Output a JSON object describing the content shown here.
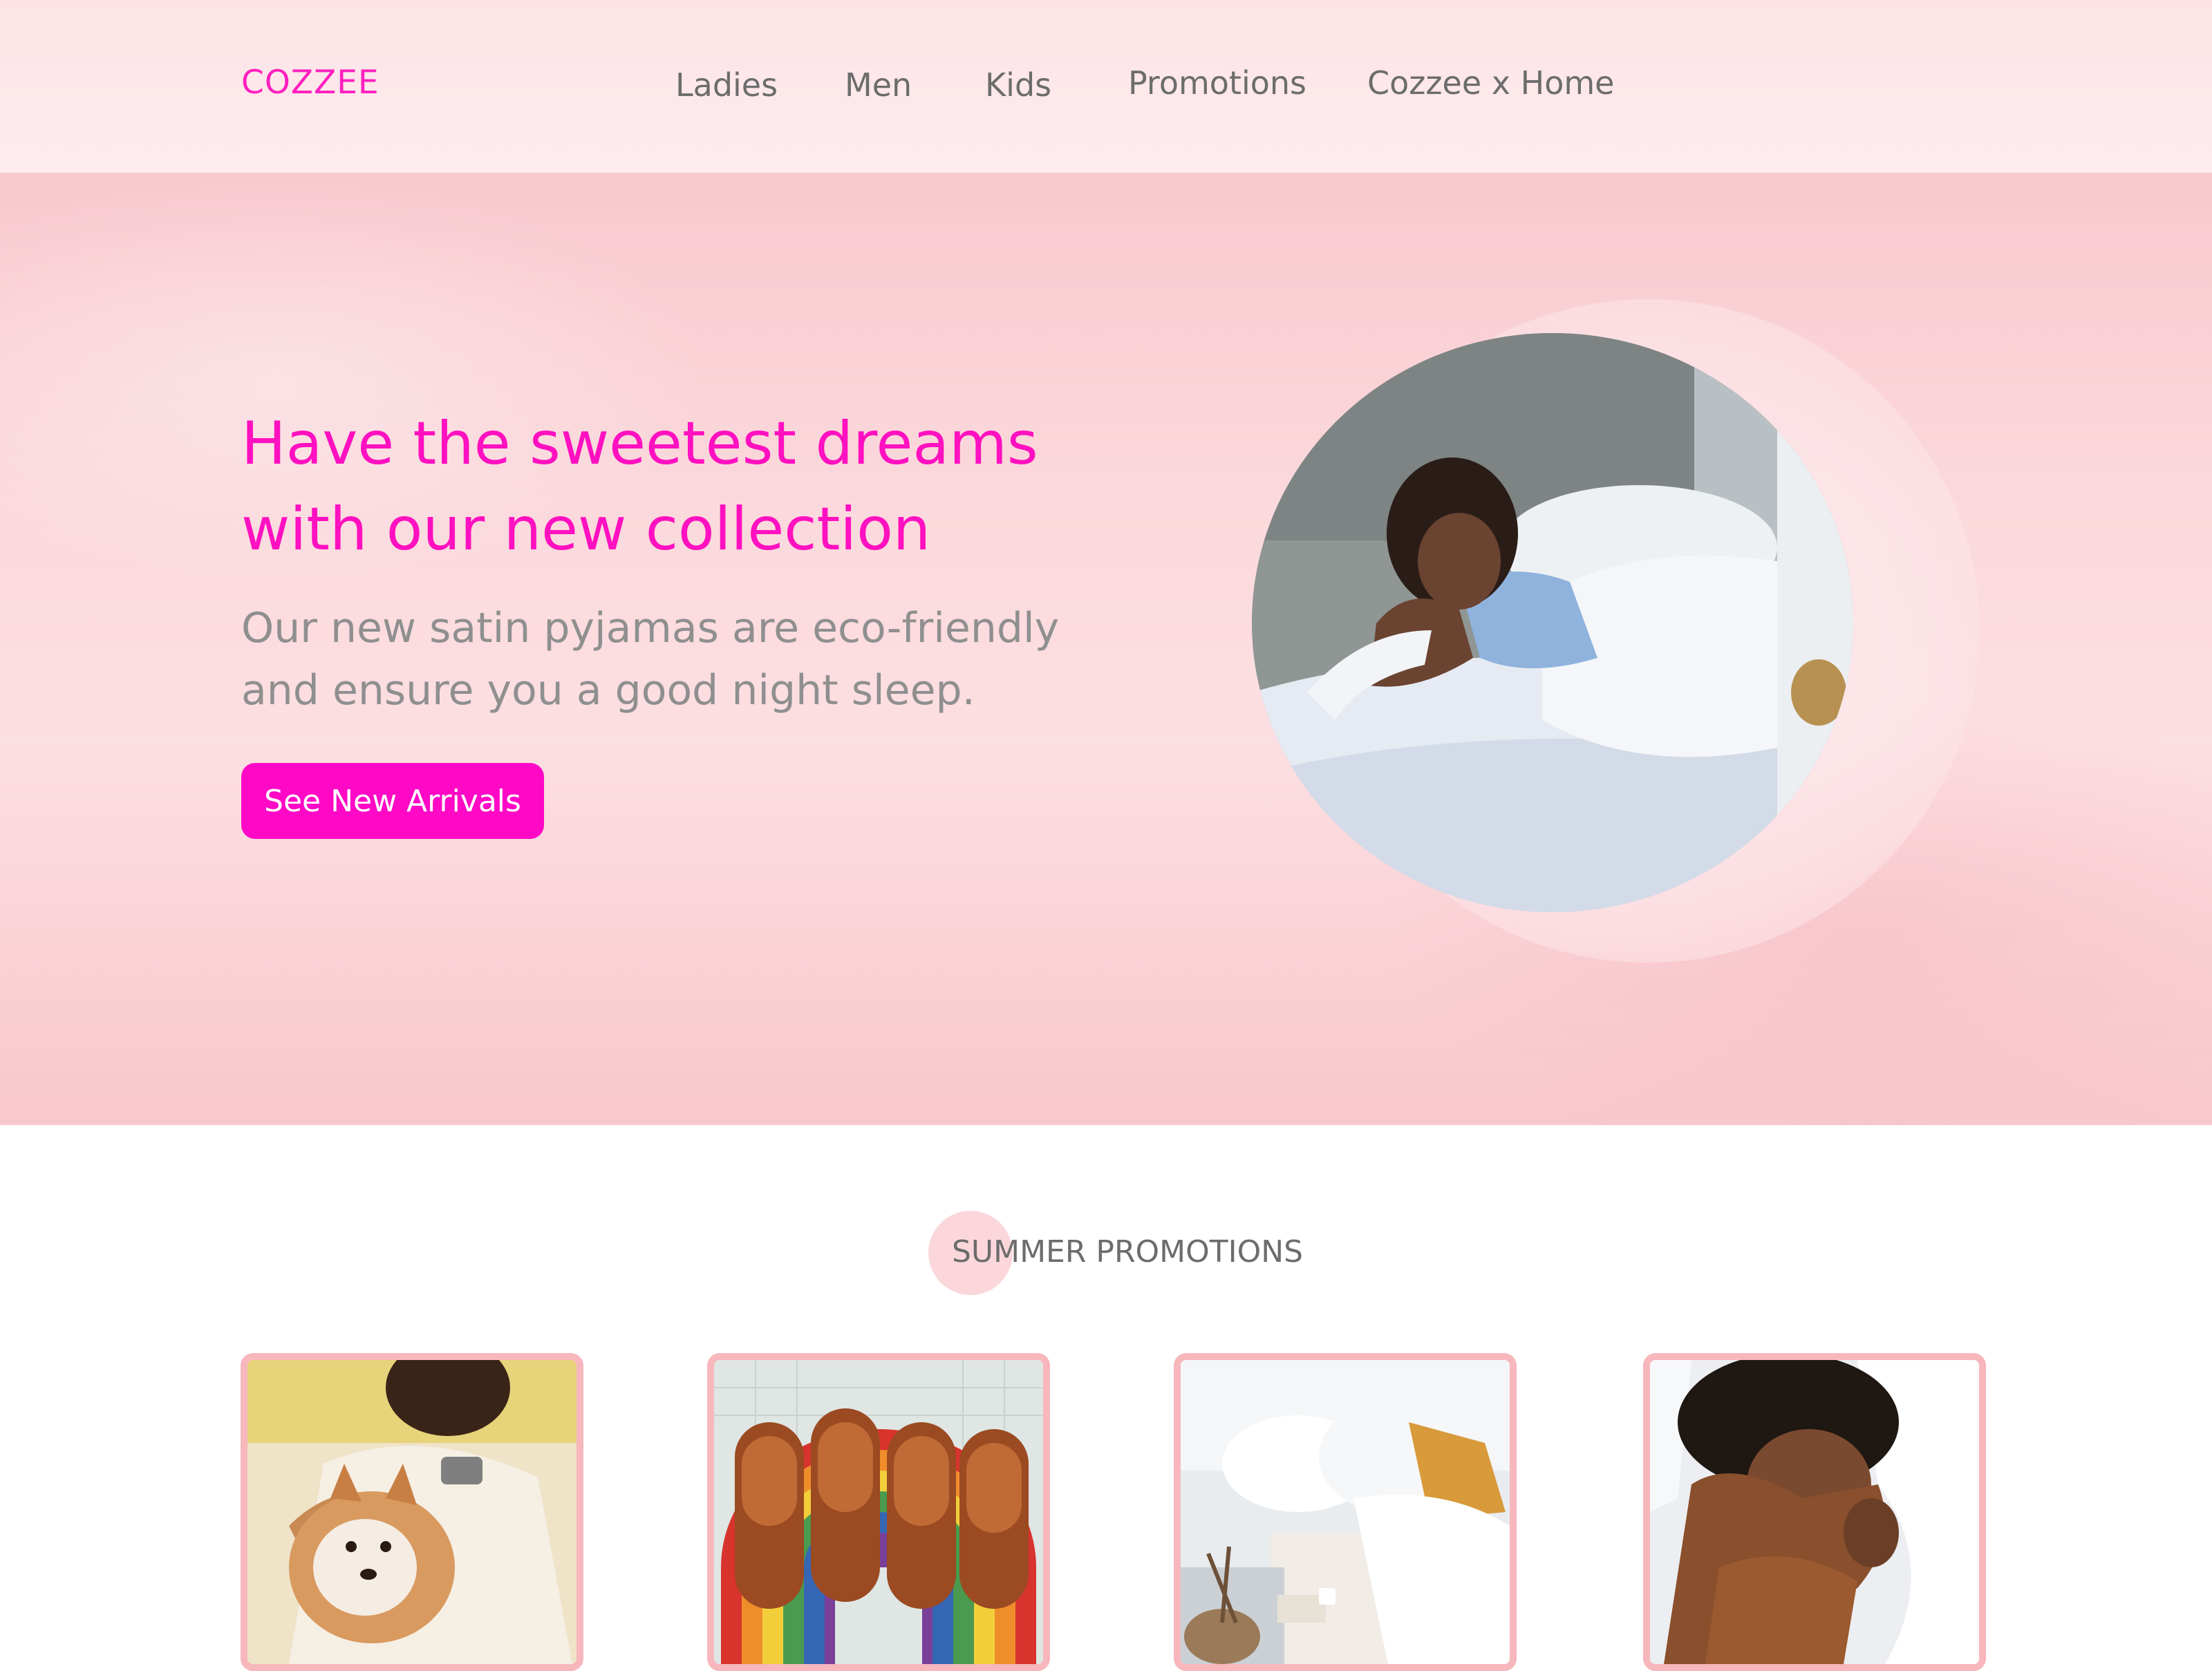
{
  "brand": {
    "logo": "COZZEE",
    "accent": "#ff10c0"
  },
  "nav": {
    "items": [
      {
        "label": "Ladies"
      },
      {
        "label": "Men"
      },
      {
        "label": "Kids"
      },
      {
        "label": "Promotions"
      },
      {
        "label": "Cozzee x Home"
      }
    ]
  },
  "hero": {
    "title": "Have the sweetest dreams with our new collection",
    "subtitle": "Our new satin pyjamas are eco-friendly and ensure you a good night sleep.",
    "cta_label": "See New Arrivals"
  },
  "promotions": {
    "heading": "SUMMER PROMOTIONS",
    "cards": [
      {
        "image": "woman-with-dog-photo"
      },
      {
        "image": "brown-slippers-on-rainbow-mat-photo"
      },
      {
        "image": "bedroom-bed-pillows-photo"
      },
      {
        "image": "child-hugging-pillow-photo"
      }
    ]
  }
}
